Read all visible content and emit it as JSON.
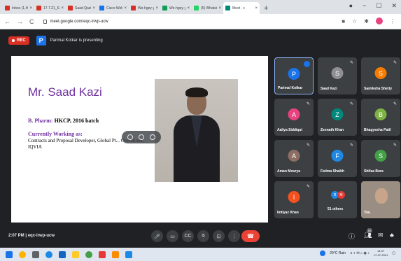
{
  "browser": {
    "tabs": [
      {
        "title": "Inbox (1,400)",
        "color": "#d93025"
      },
      {
        "title": "17.7.21_STUI",
        "color": "#d93025"
      },
      {
        "title": "Saad Qazi 17",
        "color": "#d93025"
      },
      {
        "title": "Cisco Webex",
        "color": "#1a73e8"
      },
      {
        "title": "We-hgey-ycr",
        "color": "#d93025"
      },
      {
        "title": "We-hgey-ycr",
        "color": "#0f9d58"
      },
      {
        "title": "(5) WhatsApp",
        "color": "#25d366"
      },
      {
        "title": "Meet - c",
        "color": "#00897b"
      }
    ],
    "new_tab": "+",
    "url": "meet.google.com/eqc-irwp-ucw"
  },
  "meet": {
    "rec_label": "REC",
    "presenter_badge": "P",
    "presenting_text": "Parimal Kotkar is presenting",
    "slide": {
      "name": "Mr. Saad Kazi",
      "degree_label": "B. Pharm:",
      "degree_value": "HKCP, 2016 batch",
      "working_label": "Currently Working as:",
      "role": "Contracts and Proposal Developer, Global Pr... Operations, IQVIA"
    },
    "participants": [
      {
        "name": "Parimal Kotkar",
        "initial": "P",
        "color": "#1a73e8"
      },
      {
        "name": "Saad Kazi",
        "initial": "S",
        "color": "#8e8e93"
      },
      {
        "name": "Samiksha Shetty",
        "initial": "S",
        "color": "#f57c00"
      },
      {
        "name": "Aaliya Siddiqui",
        "initial": "A",
        "color": "#e8437e"
      },
      {
        "name": "Zeenath Khan",
        "initial": "Z",
        "color": "#00897b"
      },
      {
        "name": "Bhagyesha Patil",
        "initial": "B",
        "color": "#7cb342"
      },
      {
        "name": "Aman Mourya",
        "initial": "A",
        "color": "#8d6e63"
      },
      {
        "name": "Fatima Shaikh",
        "initial": "F",
        "color": "#1e88e5"
      },
      {
        "name": "Shifaa Bora",
        "initial": "S",
        "color": "#43a047"
      },
      {
        "name": "Imtiyaz Khan",
        "initial": "I",
        "color": "#f4511e"
      }
    ],
    "others": {
      "label": "51 others",
      "initials": [
        "R",
        "M"
      ],
      "colors": [
        "#1e88e5",
        "#e53935"
      ]
    },
    "you_label": "You",
    "bottom": {
      "time": "2:07 PM",
      "separator": "|",
      "code": "eqc-irwp-ucw",
      "people_count": "62"
    }
  },
  "taskbar": {
    "weather": "29°C Rain",
    "time": "14:07",
    "date": "17-07-2021"
  }
}
